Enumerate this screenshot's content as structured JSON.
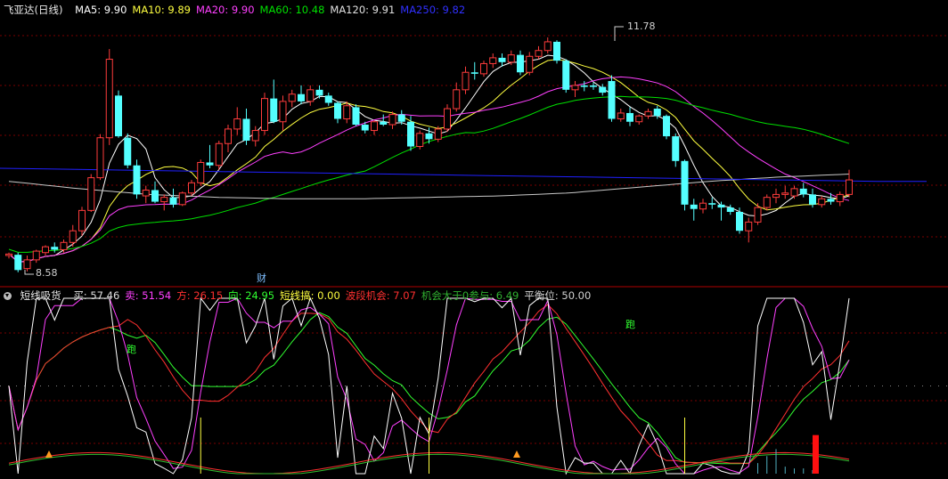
{
  "colors": {
    "up": "#ff3c3c",
    "down": "#54ffff",
    "ma5": "#ffffff",
    "ma10": "#ffff40",
    "ma20": "#ff40ff",
    "ma60": "#00e000",
    "ma120": "#c8c8c8",
    "ma250": "#2020ff",
    "grid": "#7a0000",
    "buy": "#ffffff",
    "sell": "#ff40ff",
    "fang": "#ff3030",
    "xiang": "#30ff30",
    "duanxian": "#ffff40",
    "bodong": "#ff3030",
    "jihui": "#30c030",
    "pingheng": "#d0d0d0"
  },
  "main_legend": {
    "title": "飞亚达(日线)",
    "items": [
      {
        "label": "MA5: 9.90",
        "color": "#ffffff"
      },
      {
        "label": "MA10: 9.89",
        "color": "#ffff40"
      },
      {
        "label": "MA20: 9.90",
        "color": "#ff40ff"
      },
      {
        "label": "MA60: 10.48",
        "color": "#00e000"
      },
      {
        "label": "MA120: 9.91",
        "color": "#e0e0e0"
      },
      {
        "label": "MA250: 9.82",
        "color": "#3030ff"
      }
    ]
  },
  "indicator_legend": {
    "title": "短线吸货",
    "items": [
      {
        "label": "买: 57.46",
        "color": "#e0e0e0"
      },
      {
        "label": "卖: 51.54",
        "color": "#ff40ff"
      },
      {
        "label": "方: 26.15",
        "color": "#ff3030"
      },
      {
        "label": "向: 24.95",
        "color": "#30ff30"
      },
      {
        "label": "短线搞: 0.00",
        "color": "#ffff40"
      },
      {
        "label": "波段机会: 7.07",
        "color": "#ff3030"
      },
      {
        "label": "机会大于0参与: 6.49",
        "color": "#30b030"
      },
      {
        "label": "平衡位: 50.00",
        "color": "#d0d0d0"
      }
    ]
  },
  "annotations": {
    "high": "11.78",
    "low": "8.58",
    "cai": "财",
    "pao1": "跑",
    "pao2": "跑"
  },
  "chart_data": {
    "type": "candlestick",
    "price_range": [
      8.4,
      12.05
    ],
    "indicator_range": [
      0,
      100
    ],
    "candles": [
      [
        8.78,
        8.82,
        8.74,
        8.8
      ],
      [
        8.79,
        8.82,
        8.55,
        8.58
      ],
      [
        8.6,
        8.78,
        8.56,
        8.72
      ],
      [
        8.72,
        8.86,
        8.68,
        8.84
      ],
      [
        8.82,
        8.92,
        8.78,
        8.9
      ],
      [
        8.9,
        8.96,
        8.82,
        8.86
      ],
      [
        8.86,
        9.0,
        8.82,
        8.96
      ],
      [
        8.96,
        9.2,
        8.9,
        9.12
      ],
      [
        9.12,
        9.45,
        9.05,
        9.4
      ],
      [
        9.4,
        9.9,
        9.38,
        9.85
      ],
      [
        9.85,
        10.45,
        9.82,
        10.4
      ],
      [
        10.4,
        11.62,
        10.3,
        11.48
      ],
      [
        10.98,
        11.05,
        10.4,
        10.42
      ],
      [
        10.4,
        10.46,
        9.98,
        10.02
      ],
      [
        10.02,
        10.1,
        9.56,
        9.62
      ],
      [
        9.6,
        9.74,
        9.5,
        9.68
      ],
      [
        9.68,
        9.8,
        9.5,
        9.52
      ],
      [
        9.52,
        9.62,
        9.4,
        9.58
      ],
      [
        9.58,
        9.7,
        9.44,
        9.48
      ],
      [
        9.48,
        9.66,
        9.46,
        9.64
      ],
      [
        9.64,
        9.82,
        9.6,
        9.78
      ],
      [
        9.78,
        10.1,
        9.74,
        10.06
      ],
      [
        10.06,
        10.3,
        9.98,
        10.02
      ],
      [
        10.02,
        10.36,
        9.96,
        10.32
      ],
      [
        10.32,
        10.58,
        10.2,
        10.52
      ],
      [
        10.52,
        10.82,
        10.44,
        10.66
      ],
      [
        10.66,
        10.8,
        10.3,
        10.36
      ],
      [
        10.36,
        10.56,
        10.28,
        10.5
      ],
      [
        10.5,
        11.02,
        10.44,
        10.94
      ],
      [
        10.94,
        11.2,
        10.6,
        10.62
      ],
      [
        10.62,
        10.98,
        10.5,
        10.9
      ],
      [
        10.9,
        11.06,
        10.82,
        11.0
      ],
      [
        11.0,
        11.12,
        10.86,
        10.9
      ],
      [
        10.9,
        11.12,
        10.84,
        11.06
      ],
      [
        11.06,
        11.12,
        10.94,
        10.98
      ],
      [
        10.98,
        11.02,
        10.84,
        10.88
      ],
      [
        10.88,
        10.9,
        10.6,
        10.66
      ],
      [
        10.66,
        10.9,
        10.6,
        10.84
      ],
      [
        10.82,
        10.86,
        10.56,
        10.58
      ],
      [
        10.58,
        10.62,
        10.46,
        10.5
      ],
      [
        10.5,
        10.64,
        10.44,
        10.62
      ],
      [
        10.62,
        10.72,
        10.56,
        10.58
      ],
      [
        10.58,
        10.76,
        10.52,
        10.72
      ],
      [
        10.72,
        10.78,
        10.58,
        10.62
      ],
      [
        10.62,
        10.7,
        10.22,
        10.28
      ],
      [
        10.28,
        10.5,
        10.24,
        10.46
      ],
      [
        10.46,
        10.54,
        10.32,
        10.38
      ],
      [
        10.38,
        10.56,
        10.34,
        10.52
      ],
      [
        10.52,
        10.86,
        10.48,
        10.8
      ],
      [
        10.8,
        11.16,
        10.76,
        11.06
      ],
      [
        11.06,
        11.38,
        11.0,
        11.3
      ],
      [
        11.3,
        11.44,
        11.2,
        11.28
      ],
      [
        11.28,
        11.46,
        11.24,
        11.42
      ],
      [
        11.42,
        11.56,
        11.36,
        11.5
      ],
      [
        11.5,
        11.56,
        11.38,
        11.44
      ],
      [
        11.44,
        11.6,
        11.4,
        11.54
      ],
      [
        11.54,
        11.6,
        11.26,
        11.3
      ],
      [
        11.3,
        11.58,
        11.26,
        11.52
      ],
      [
        11.52,
        11.66,
        11.48,
        11.6
      ],
      [
        11.6,
        11.78,
        11.56,
        11.72
      ],
      [
        11.72,
        11.74,
        11.42,
        11.46
      ],
      [
        11.46,
        11.48,
        11.02,
        11.06
      ],
      [
        11.06,
        11.18,
        10.96,
        11.12
      ],
      [
        11.12,
        11.18,
        11.04,
        11.1
      ],
      [
        11.12,
        11.16,
        11.06,
        11.1
      ],
      [
        11.1,
        11.14,
        10.98,
        11.02
      ],
      [
        11.18,
        11.26,
        10.62,
        10.66
      ],
      [
        10.66,
        10.8,
        10.62,
        10.74
      ],
      [
        10.74,
        10.82,
        10.56,
        10.62
      ],
      [
        10.62,
        10.72,
        10.58,
        10.7
      ],
      [
        10.7,
        10.8,
        10.66,
        10.76
      ],
      [
        10.8,
        10.84,
        10.66,
        10.7
      ],
      [
        10.7,
        10.72,
        10.38,
        10.42
      ],
      [
        10.42,
        10.46,
        10.0,
        10.08
      ],
      [
        10.08,
        10.1,
        9.4,
        9.48
      ],
      [
        9.48,
        9.56,
        9.26,
        9.42
      ],
      [
        9.42,
        9.56,
        9.36,
        9.5
      ],
      [
        9.5,
        9.58,
        9.42,
        9.48
      ],
      [
        9.48,
        9.52,
        9.26,
        9.44
      ],
      [
        9.44,
        9.48,
        9.34,
        9.38
      ],
      [
        9.38,
        9.44,
        9.08,
        9.12
      ],
      [
        9.12,
        9.3,
        8.96,
        9.24
      ],
      [
        9.24,
        9.5,
        9.2,
        9.44
      ],
      [
        9.44,
        9.62,
        9.4,
        9.58
      ],
      [
        9.58,
        9.7,
        9.5,
        9.62
      ],
      [
        9.62,
        9.74,
        9.56,
        9.64
      ],
      [
        9.6,
        9.74,
        9.56,
        9.7
      ],
      [
        9.7,
        9.78,
        9.58,
        9.62
      ],
      [
        9.62,
        9.7,
        9.44,
        9.48
      ],
      [
        9.48,
        9.6,
        9.44,
        9.56
      ],
      [
        9.56,
        9.64,
        9.48,
        9.52
      ],
      [
        9.52,
        9.66,
        9.46,
        9.62
      ],
      [
        9.62,
        9.96,
        9.58,
        9.82
      ]
    ],
    "ma250": [
      9.98,
      9.97,
      9.96,
      9.95,
      9.94,
      9.93,
      9.92,
      9.91,
      9.9,
      9.89,
      9.88,
      9.87,
      9.86,
      9.85,
      9.84,
      9.83,
      9.82,
      9.81,
      9.8,
      9.8
    ]
  }
}
